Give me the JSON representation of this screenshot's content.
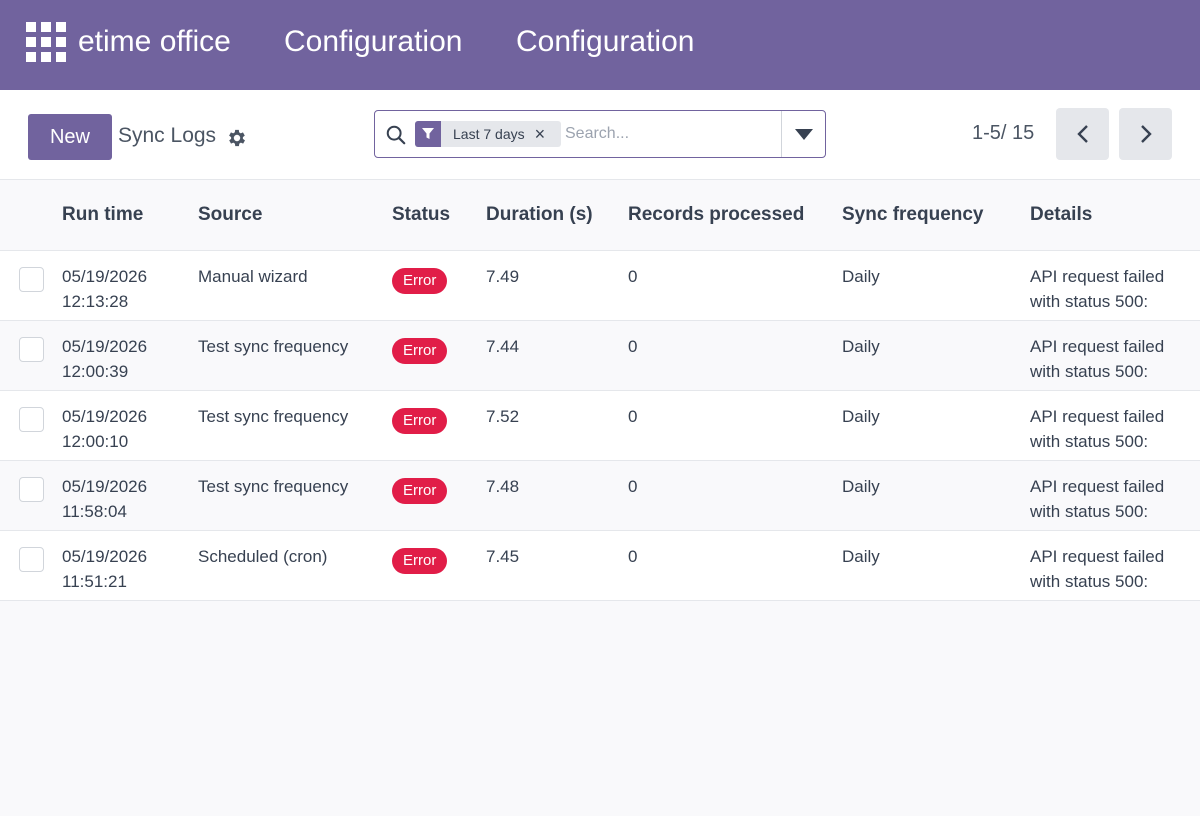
{
  "navbar": {
    "brand": "etime office",
    "menu_1": "Configuration",
    "menu_2": "Configuration"
  },
  "control_panel": {
    "new_label": "New",
    "breadcrumb": "Sync Logs",
    "search": {
      "facet_label": "Last 7 days",
      "facet_remove": "×",
      "placeholder": "Search..."
    },
    "pager": {
      "value": "1-5/ 15"
    }
  },
  "table": {
    "headers": [
      "Run time",
      "Source",
      "Status",
      "Duration (s)",
      "Records processed",
      "Sync frequency",
      "Details"
    ],
    "rows": [
      {
        "date": "05/19/2026",
        "time": "12:13:28",
        "source": "Manual wizard",
        "status": "Error",
        "duration": "7.49",
        "records": "0",
        "frequency": "Daily",
        "details_1": "API request failed",
        "details_2": "with status 500:"
      },
      {
        "date": "05/19/2026",
        "time": "12:00:39",
        "source": "Test sync frequency",
        "status": "Error",
        "duration": "7.44",
        "records": "0",
        "frequency": "Daily",
        "details_1": "API request failed",
        "details_2": "with status 500:"
      },
      {
        "date": "05/19/2026",
        "time": "12:00:10",
        "source": "Test sync frequency",
        "status": "Error",
        "duration": "7.52",
        "records": "0",
        "frequency": "Daily",
        "details_1": "API request failed",
        "details_2": "with status 500:"
      },
      {
        "date": "05/19/2026",
        "time": "11:58:04",
        "source": "Test sync frequency",
        "status": "Error",
        "duration": "7.48",
        "records": "0",
        "frequency": "Daily",
        "details_1": "API request failed",
        "details_2": "with status 500:"
      },
      {
        "date": "05/19/2026",
        "time": "11:51:21",
        "source": "Scheduled (cron)",
        "status": "Error",
        "duration": "7.45",
        "records": "0",
        "frequency": "Daily",
        "details_1": "API request failed",
        "details_2": "with status 500:"
      }
    ]
  },
  "colors": {
    "brand": "#71639e",
    "error": "#e11d48"
  },
  "icons": [
    "apps-grid-icon",
    "gear-icon",
    "search-icon",
    "filter-icon",
    "close-icon",
    "caret-down-icon",
    "chevron-left-icon",
    "chevron-right-icon"
  ]
}
